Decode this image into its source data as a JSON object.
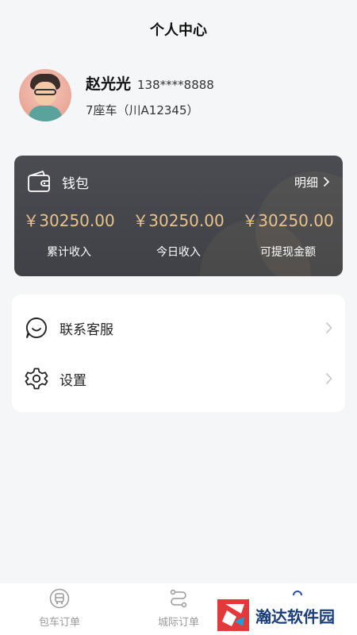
{
  "header": {
    "title": "个人中心"
  },
  "profile": {
    "name": "赵光光",
    "phone": "138****8888",
    "vehicle": "7座车（川A12345）"
  },
  "wallet": {
    "title": "钱包",
    "detail_label": "明细",
    "items": [
      {
        "value": "￥30250.00",
        "label": "累计收入"
      },
      {
        "value": "￥30250.00",
        "label": "今日收入"
      },
      {
        "value": "￥30250.00",
        "label": "可提现金额"
      }
    ],
    "colors": {
      "card": "#45464b",
      "amount": "#e8c38a"
    }
  },
  "menu": {
    "items": [
      {
        "icon": "chat-icon",
        "label": "联系客服"
      },
      {
        "icon": "gear-icon",
        "label": "设置"
      }
    ]
  },
  "tabbar": {
    "items": [
      {
        "icon": "bus-icon",
        "label": "包车订单"
      },
      {
        "icon": "route-icon",
        "label": "城际订单"
      },
      {
        "icon": "user-icon",
        "label": ""
      }
    ]
  },
  "watermark": {
    "text": "瀚达软件园"
  }
}
